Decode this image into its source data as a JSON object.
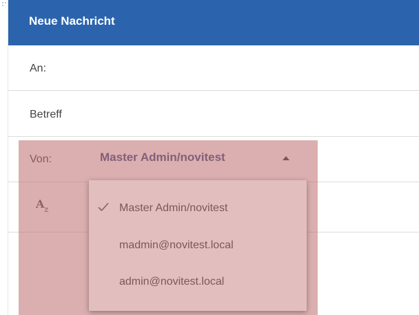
{
  "header": {
    "title": "Neue Nachricht"
  },
  "fields": {
    "to_label": "An:",
    "subject_placeholder": "Betreff",
    "from_label": "Von:",
    "from_value": "Master Admin/novitest"
  },
  "from_dropdown": {
    "expanded": true,
    "selected": "Master Admin/novitest",
    "options": [
      {
        "label": "Master Admin/novitest",
        "checked": true
      },
      {
        "label": "madmin@novitest.local",
        "checked": false
      },
      {
        "label": "admin@novitest.local",
        "checked": false
      }
    ]
  },
  "icons": {
    "format": "text-format-icon",
    "check": "check-icon",
    "caret": "caret-up-icon"
  },
  "colors": {
    "header_bg": "#2b64ad",
    "header_text": "#ffffff",
    "from_value_text": "#3a4f8a",
    "highlight": "#be6e6e"
  }
}
